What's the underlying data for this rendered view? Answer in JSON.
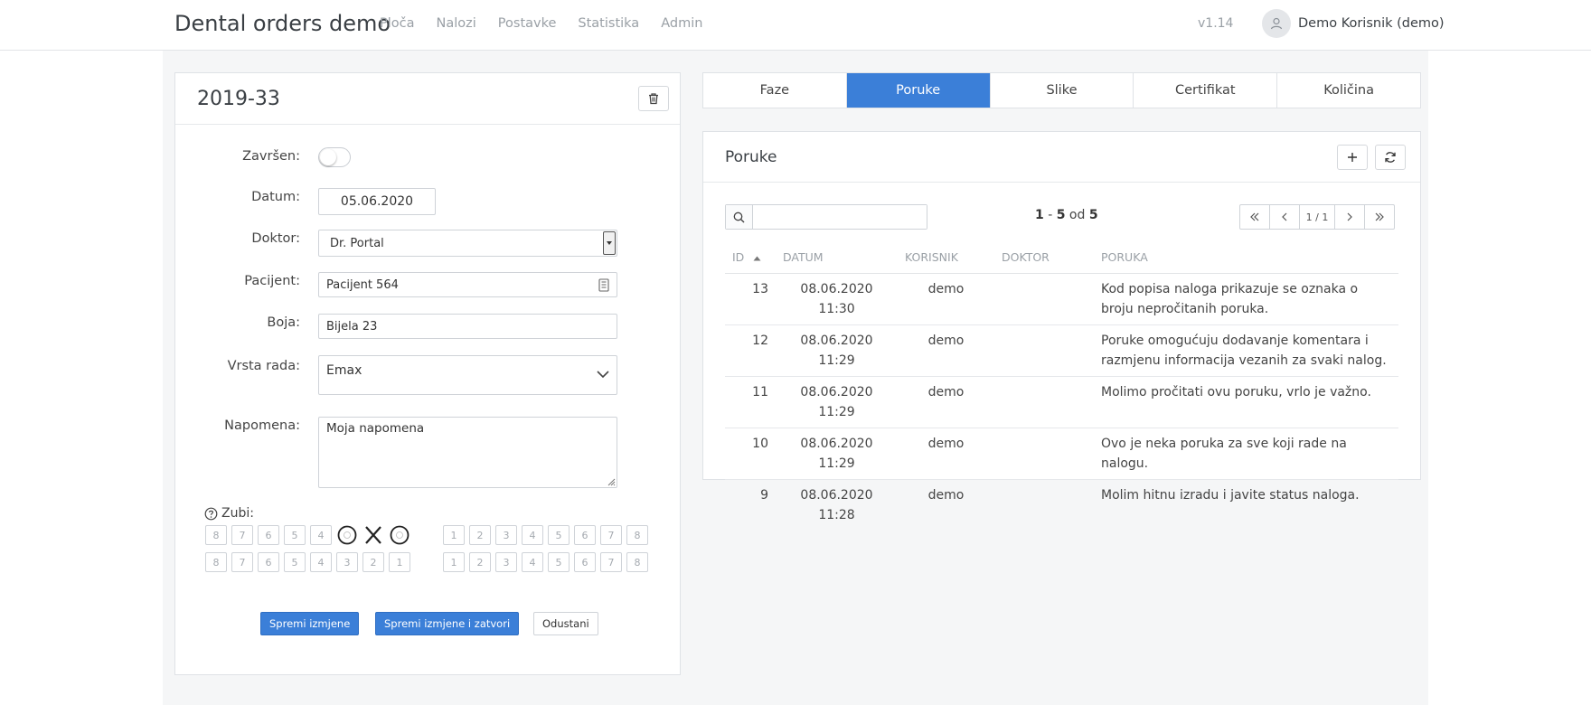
{
  "header": {
    "brand": "Dental orders demo",
    "nav": [
      "Ploča",
      "Nalozi",
      "Postavke",
      "Statistika",
      "Admin"
    ],
    "version": "v1.14",
    "user": "Demo Korisnik (demo)"
  },
  "order": {
    "number": "2019-33",
    "fields": {
      "finished_label": "Završen:",
      "date_label": "Datum:",
      "date_value": "05.06.2020",
      "doctor_label": "Doktor:",
      "doctor_value": "Dr. Portal",
      "patient_label": "Pacijent:",
      "patient_value": "Pacijent 564",
      "color_label": "Boja:",
      "color_value": "Bijela 23",
      "worktype_label": "Vrsta rada:",
      "worktype_value": "Emax",
      "note_label": "Napomena:",
      "note_value": "Moja napomena"
    },
    "teeth_label": "Zubi:",
    "teeth": {
      "upper_right": [
        "8",
        "7",
        "6",
        "5",
        "4",
        "3",
        "2",
        "1"
      ],
      "upper_left": [
        "1",
        "2",
        "3",
        "4",
        "5",
        "6",
        "7",
        "8"
      ],
      "lower_right": [
        "8",
        "7",
        "6",
        "5",
        "4",
        "3",
        "2",
        "1"
      ],
      "lower_left": [
        "1",
        "2",
        "3",
        "4",
        "5",
        "6",
        "7",
        "8"
      ]
    },
    "buttons": {
      "save": "Spremi izmjene",
      "save_close": "Spremi izmjene i zatvori",
      "cancel": "Odustani"
    }
  },
  "tabs": [
    "Faze",
    "Poruke",
    "Slike",
    "Certifikat",
    "Količina"
  ],
  "messages": {
    "title": "Poruke",
    "range_start": "1",
    "range_end": "5",
    "range_of": "od",
    "range_total": "5",
    "page": "1 / 1",
    "columns": [
      "ID",
      "DATUM",
      "KORISNIK",
      "DOKTOR",
      "PORUKA"
    ],
    "rows": [
      {
        "id": "13",
        "date": "08.06.2020 11:30",
        "user": "demo",
        "doctor": "",
        "message": "Kod popisa naloga prikazuje se oznaka o broju nepročitanih poruka."
      },
      {
        "id": "12",
        "date": "08.06.2020 11:29",
        "user": "demo",
        "doctor": "",
        "message": "Poruke omogućuju dodavanje komentara i razmjenu informacija vezanih za svaki nalog."
      },
      {
        "id": "11",
        "date": "08.06.2020 11:29",
        "user": "demo",
        "doctor": "",
        "message": "Molimo pročitati ovu poruku, vrlo je važno."
      },
      {
        "id": "10",
        "date": "08.06.2020 11:29",
        "user": "demo",
        "doctor": "",
        "message": "Ovo je neka poruka za sve koji rade na nalogu."
      },
      {
        "id": "9",
        "date": "08.06.2020 11:28",
        "user": "demo",
        "doctor": "",
        "message": "Molim hitnu izradu i javite status naloga."
      }
    ]
  },
  "colors": {
    "accent": "#3b7fd8"
  },
  "icons": [
    "user-icon",
    "trash-icon",
    "id-card-icon",
    "chevron-down-icon",
    "help-circle-icon",
    "plus-icon",
    "refresh-icon",
    "search-icon",
    "first-page-icon",
    "prev-page-icon",
    "next-page-icon",
    "last-page-icon",
    "sort-asc-icon"
  ]
}
